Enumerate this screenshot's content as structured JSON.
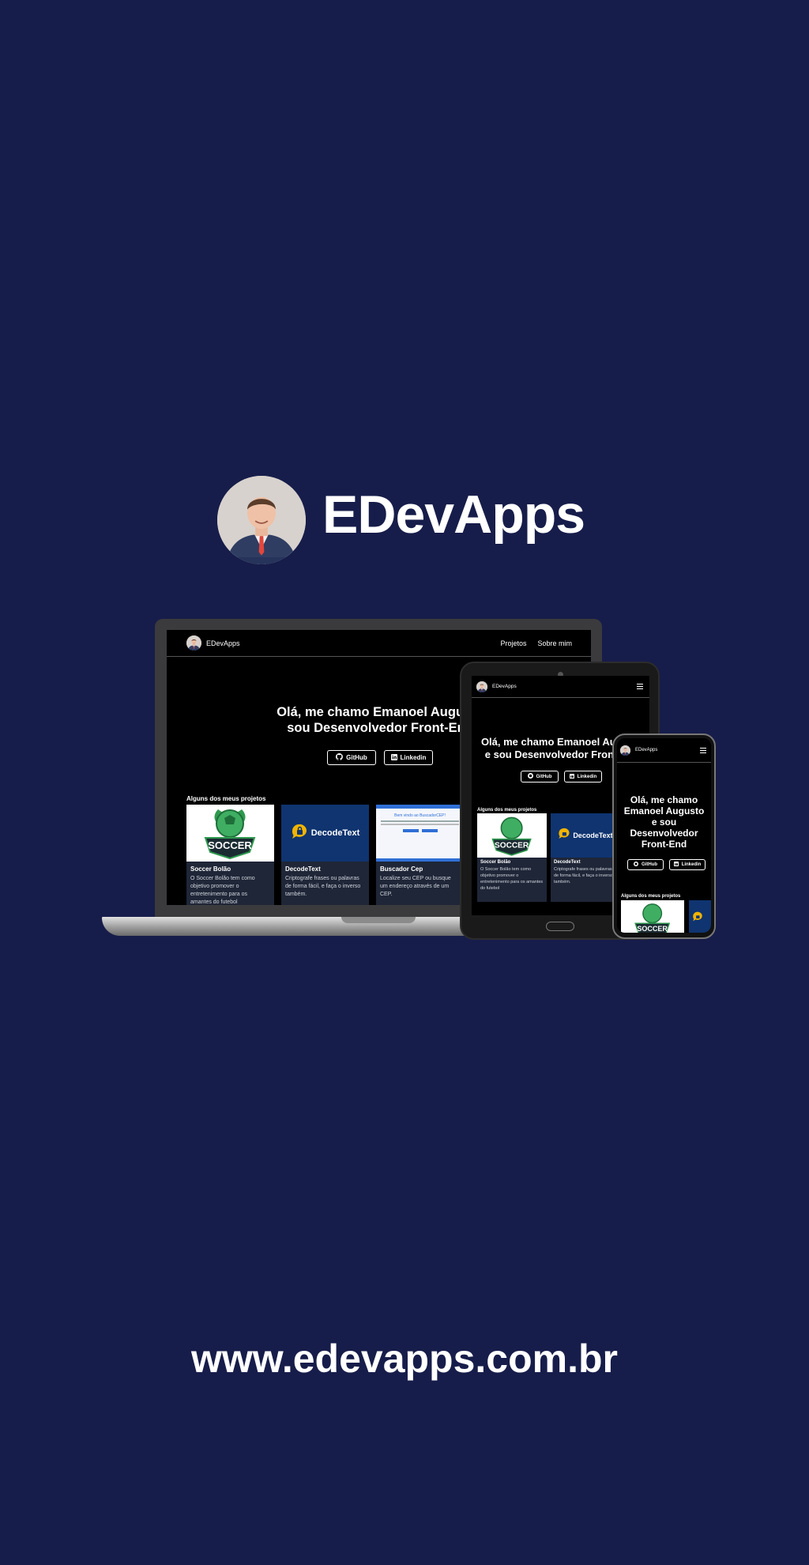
{
  "brand": {
    "title": "EDevApps"
  },
  "footer": {
    "url": "www.edevapps.com.br"
  },
  "site": {
    "nav_name": "EDevApps",
    "nav_links": [
      "Projetos",
      "Sobre mim"
    ],
    "hero_laptop": "Olá, me chamo Emanoel Augusto\nsou Desenvolvedor Front-End",
    "hero_tablet": "Olá, me chamo Emanoel Augusto\ne sou Desenvolvedor Front-End",
    "hero_phone": "Olá, me chamo\nEmanoel Augusto\ne sou\nDesenvolvedor\nFront-End",
    "github_label": "GitHub",
    "linkedin_label": "Linkedin",
    "projects_heading": "Alguns dos meus projetos",
    "projects": [
      {
        "title": "Soccer Bolão",
        "desc": "O Soccer Bolão tem como objetivo promover o entretenimento para os amantes do futebol"
      },
      {
        "title": "DecodeText",
        "desc": "Criptografe frases ou palavras de forma fácil, e faça o inverso também."
      },
      {
        "title": "Buscador Cep",
        "desc": "Localize seu CEP ou busque um endereço através de um CEP."
      }
    ],
    "logo_soccer_text": "SOCCER",
    "logo_decode_text": "DecodeText",
    "cep_page_title": "Bem vindo ao BuscadorCEP!"
  },
  "colors": {
    "background": "#171d4a",
    "card": "#1f2637",
    "decode_blue": "#0f3470"
  }
}
